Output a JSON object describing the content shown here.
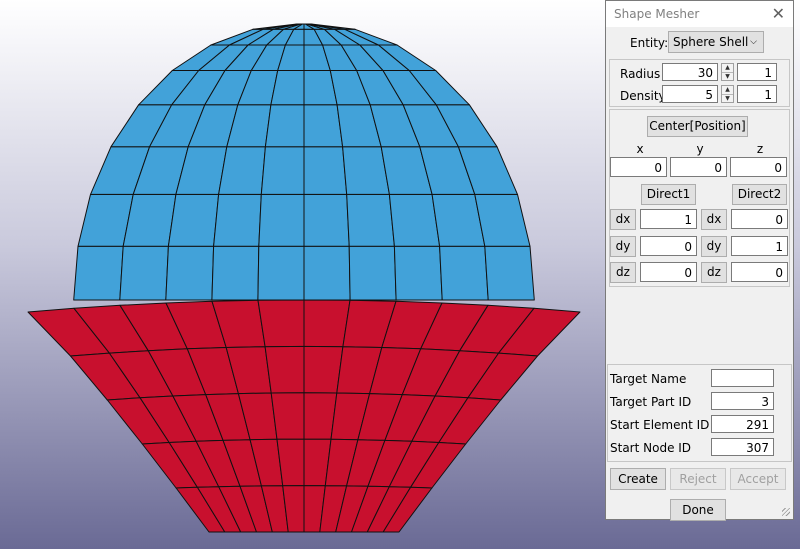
{
  "viewport": {
    "hemisphere_top_color": "#42a2d9",
    "hemisphere_bottom_color": "#c8102e",
    "edge_color": "#111111"
  },
  "dialog": {
    "title": "Shape Mesher",
    "close_icon": "close-icon",
    "entity_label": "Entity:",
    "entity_value": "Sphere Shell",
    "radius_label": "Radius",
    "radius_value": "30",
    "radius_step": "1",
    "density_label": "Density",
    "density_value": "5",
    "density_step": "1",
    "center_button": "Center[Position]",
    "x_label": "x",
    "y_label": "y",
    "z_label": "z",
    "x_value": "0",
    "y_value": "0",
    "z_value": "0",
    "direct1_button": "Direct1",
    "direct2_button": "Direct2",
    "dx_label": "dx",
    "dy_label": "dy",
    "dz_label": "dz",
    "d1": {
      "dx": "1",
      "dy": "0",
      "dz": "0"
    },
    "d2": {
      "dx": "0",
      "dy": "1",
      "dz": "0"
    },
    "target_name_label": "Target Name",
    "target_name_value": "",
    "target_part_label": "Target Part ID",
    "target_part_value": "3",
    "start_element_label": "Start Element ID",
    "start_element_value": "291",
    "start_node_label": "Start Node ID",
    "start_node_value": "307",
    "create_button": "Create",
    "reject_button": "Reject",
    "accept_button": "Accept",
    "done_button": "Done"
  }
}
